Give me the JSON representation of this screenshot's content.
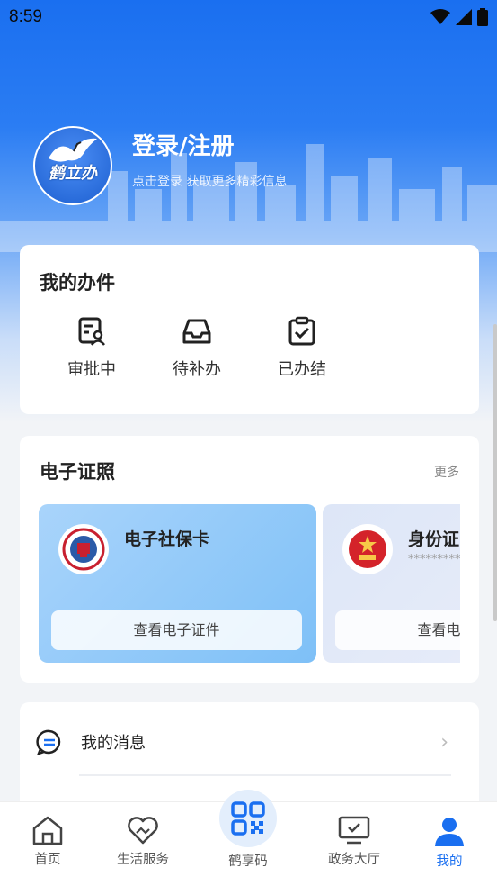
{
  "status_bar": {
    "time": "8:59"
  },
  "profile": {
    "logo_text": "鹤立办",
    "title": "登录/注册",
    "subtitle": "点击登录 获取更多精彩信息"
  },
  "my_tasks": {
    "title": "我的办件",
    "items": [
      {
        "label": "审批中",
        "icon": "document-user-icon"
      },
      {
        "label": "待补办",
        "icon": "inbox-icon"
      },
      {
        "label": "已办结",
        "icon": "clipboard-check-icon"
      }
    ]
  },
  "certificates": {
    "title": "电子证照",
    "more": "更多",
    "cards": [
      {
        "name": "电子社保卡",
        "masked": "",
        "button": "查看电子证件",
        "icon": "social-security-emblem-icon"
      },
      {
        "name": "身份证",
        "masked": "**********",
        "button": "查看电子证件",
        "icon": "national-emblem-icon"
      }
    ]
  },
  "list": {
    "items": [
      {
        "label": "我的消息",
        "icon": "message-icon"
      }
    ]
  },
  "tabbar": {
    "items": [
      {
        "label": "首页",
        "icon": "home-icon"
      },
      {
        "label": "生活服务",
        "icon": "handshake-heart-icon"
      },
      {
        "label": "鹤享码",
        "icon": "qr-code-icon"
      },
      {
        "label": "政务大厅",
        "icon": "monitor-check-icon"
      },
      {
        "label": "我的",
        "icon": "user-icon"
      }
    ],
    "active": "我的",
    "accent": "#1a6ff0"
  }
}
